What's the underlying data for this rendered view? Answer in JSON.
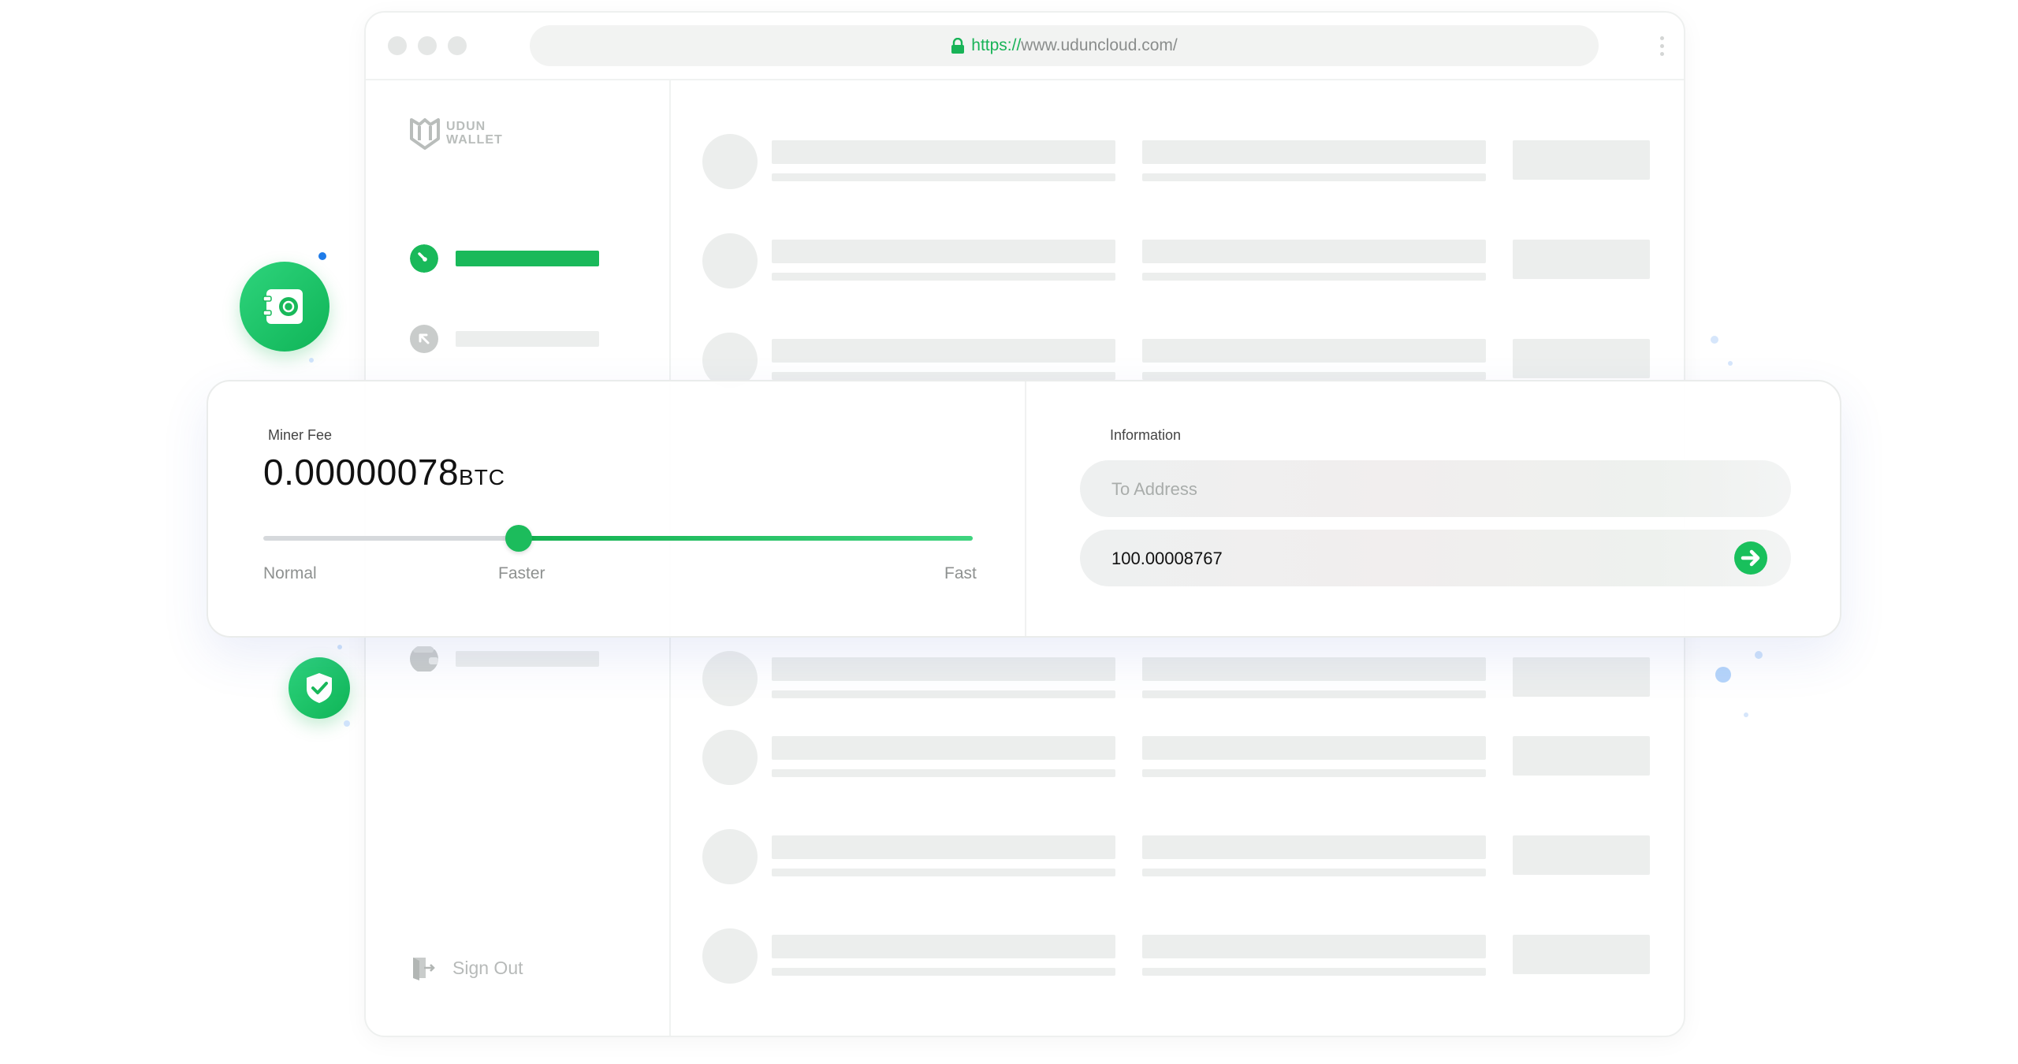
{
  "browser": {
    "url_protocol": "https://",
    "url_rest": "www.uduncloud.com/"
  },
  "sidebar": {
    "logo_line1": "UDUN",
    "logo_line2": "WALLET",
    "sign_out_label": "Sign Out"
  },
  "fee_panel": {
    "label": "Miner Fee",
    "value": "0.00000078",
    "unit": "BTC",
    "speed_level_fraction": 0.36,
    "tick_normal": "Normal",
    "tick_faster": "Faster",
    "tick_fast": "Fast"
  },
  "info_panel": {
    "label": "Information",
    "address_placeholder": "To Address",
    "amount_value": "100.00008767"
  },
  "colors": {
    "accent_green": "#18b357",
    "skeleton_gray": "#eceeed"
  },
  "icons": [
    "lock-icon",
    "udun-logo-icon",
    "dashboard-gauge-icon",
    "withdraw-arrow-icon",
    "wallet-icon",
    "sign-out-icon",
    "arrow-right-icon",
    "safe-vault-icon",
    "shield-check-icon"
  ]
}
